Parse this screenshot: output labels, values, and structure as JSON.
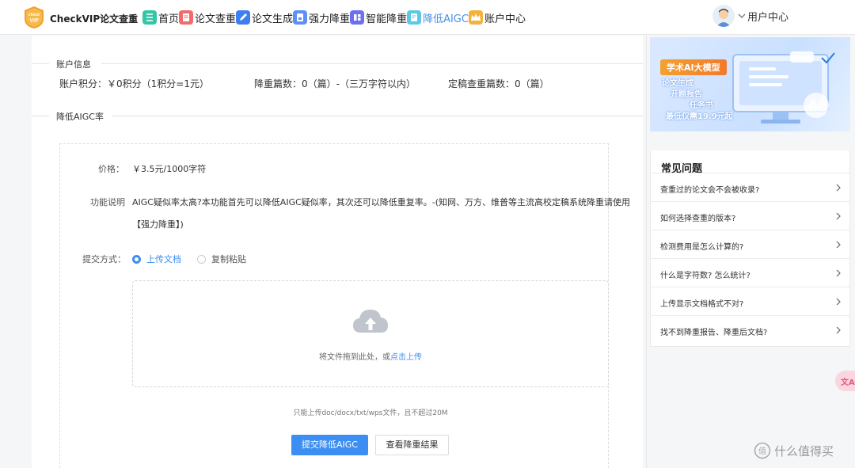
{
  "header": {
    "brand": "CheckVIP论文查重",
    "logo_text": "check VIP",
    "nav": [
      {
        "label": "首页",
        "icon": "list-icon",
        "color": "#35c6a8",
        "active": false
      },
      {
        "label": "论文查重",
        "icon": "document-icon",
        "color": "#f26b6b",
        "active": false
      },
      {
        "label": "论文生成",
        "icon": "edit-icon",
        "color": "#3f7ef2",
        "active": false
      },
      {
        "label": "强力降重",
        "icon": "file-lock-icon",
        "color": "#5f8ff6",
        "active": false
      },
      {
        "label": "智能降重",
        "icon": "grid-icon",
        "color": "#6b6ff0",
        "active": false
      },
      {
        "label": "降低AIGC",
        "icon": "doc-ai-icon",
        "color": "#5bc8e6",
        "active": true
      },
      {
        "label": "账户中心",
        "icon": "crown-icon",
        "color": "#f5b13e",
        "active": false
      }
    ],
    "user_label": "用户中心"
  },
  "account": {
    "section_title": "账户信息",
    "points": "账户积分：￥0积分（1积分=1元）",
    "reduce_count": "降重篇数：0（篇）-（三万字符以内）",
    "final_count": "定稿查重篇数：0（篇）"
  },
  "aigc": {
    "section_title": "降低AIGC率",
    "price_label": "价格：",
    "price_value": "￥3.5元/1000字符",
    "desc_label": "功能说明",
    "desc_value_1": "AIGC疑似率太高?本功能首先可以降低AIGC疑似率，其次还可以降低重复率。-(知网、万方、维普等主流高校定稿系统降重请使用",
    "desc_value_2": "【强力降重】)",
    "submit_label": "提交方式：",
    "options": [
      {
        "label": "上传文档",
        "selected": true
      },
      {
        "label": "复制粘贴",
        "selected": false
      }
    ],
    "drop_text": "将文件拖到此处，或",
    "drop_link": "点击上传",
    "hint": "只能上传doc/docx/txt/wps文件，且不超过20M",
    "submit_button": "提交降低AIGC",
    "view_button": "查看降重结果"
  },
  "sidebar": {
    "banner": {
      "tag": "学术AI大模型",
      "line1": "论文生成",
      "line2": "开题报告",
      "line3": "任务书",
      "line4": "最低仅需19.9元起",
      "badge": "AI"
    },
    "faq_title": "常见问题",
    "faq": [
      "查重过的论文会不会被收录?",
      "如何选择查重的版本?",
      "检测费用是怎么计算的?",
      "什么是字符数? 怎么统计?",
      "上传显示文档格式不对?",
      "找不到降重报告、降重后文档?"
    ]
  },
  "floating": {
    "label": "文A"
  },
  "watermark": {
    "text": "什么值得买"
  }
}
